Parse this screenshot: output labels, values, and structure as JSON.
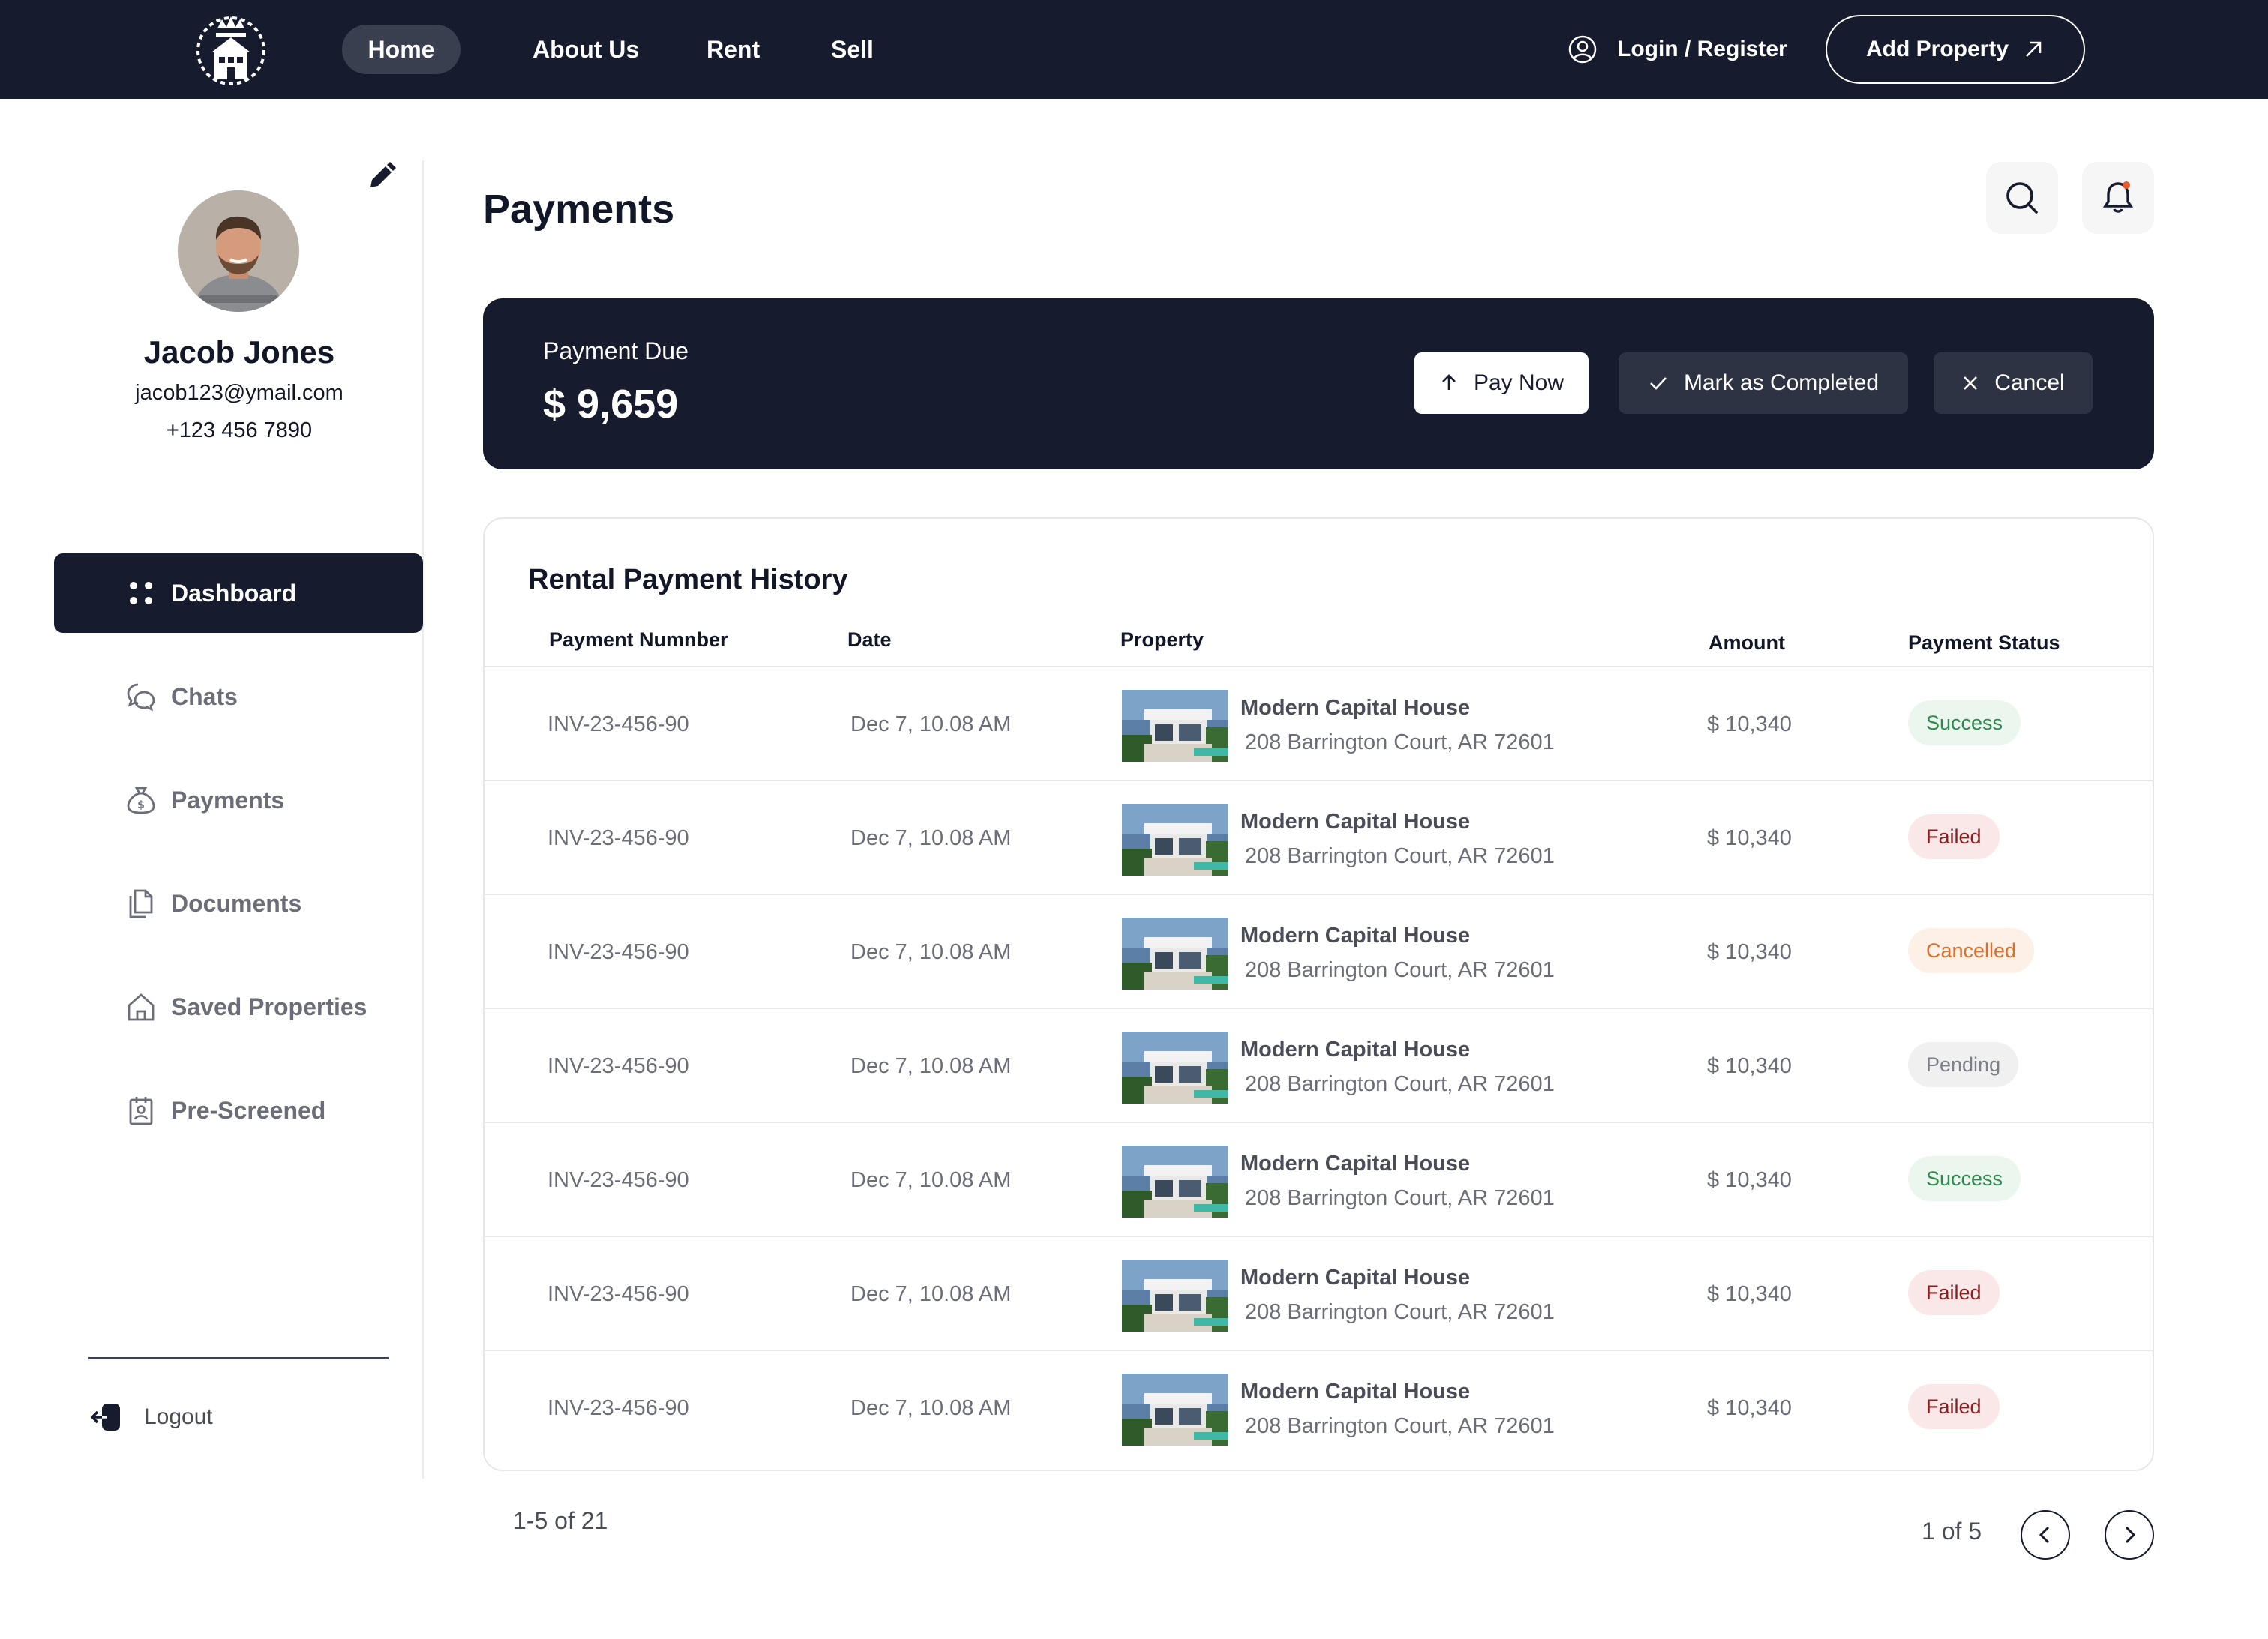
{
  "nav": {
    "links": [
      "Home",
      "About Us",
      "Rent",
      "Sell"
    ],
    "login_label": "Login / Register",
    "add_property_label": "Add Property"
  },
  "profile": {
    "name": "Jacob Jones",
    "email": "jacob123@ymail.com",
    "phone": "+123 456 7890"
  },
  "sidebar": {
    "items": [
      {
        "label": "Dashboard",
        "icon": "grid-dots-icon",
        "active": true
      },
      {
        "label": "Chats",
        "icon": "chat-bubbles-icon",
        "active": false
      },
      {
        "label": "Payments",
        "icon": "money-bag-icon",
        "active": false
      },
      {
        "label": "Documents",
        "icon": "documents-icon",
        "active": false
      },
      {
        "label": "Saved Properties",
        "icon": "home-icon",
        "active": false
      },
      {
        "label": "Pre-Screened",
        "icon": "clipboard-user-icon",
        "active": false
      }
    ],
    "logout_label": "Logout"
  },
  "main": {
    "title": "Payments",
    "due": {
      "label": "Payment Due",
      "amount": "$ 9,659",
      "pay_now": "Pay Now",
      "mark_completed": "Mark as Completed",
      "cancel": "Cancel"
    },
    "history": {
      "title": "Rental Payment History",
      "columns": [
        "Payment Numnber",
        "Date",
        "Property",
        "Amount",
        "Payment Status"
      ],
      "rows": [
        {
          "number": "INV-23-456-90",
          "date": "Dec 7, 10.08 AM",
          "property": "Modern Capital House",
          "address": "208 Barrington Court, AR 72601",
          "amount": "$ 10,340",
          "status": "Success",
          "status_kind": "success"
        },
        {
          "number": "INV-23-456-90",
          "date": "Dec 7, 10.08 AM",
          "property": "Modern Capital House",
          "address": "208 Barrington Court, AR 72601",
          "amount": "$ 10,340",
          "status": "Failed",
          "status_kind": "failed"
        },
        {
          "number": "INV-23-456-90",
          "date": "Dec 7, 10.08 AM",
          "property": "Modern Capital House",
          "address": "208 Barrington Court, AR 72601",
          "amount": "$ 10,340",
          "status": "Cancelled",
          "status_kind": "cancelled"
        },
        {
          "number": "INV-23-456-90",
          "date": "Dec 7, 10.08 AM",
          "property": "Modern Capital House",
          "address": "208 Barrington Court, AR 72601",
          "amount": "$ 10,340",
          "status": "Pending",
          "status_kind": "pending"
        },
        {
          "number": "INV-23-456-90",
          "date": "Dec 7, 10.08 AM",
          "property": "Modern Capital House",
          "address": "208 Barrington Court, AR 72601",
          "amount": "$ 10,340",
          "status": "Success",
          "status_kind": "success"
        },
        {
          "number": "INV-23-456-90",
          "date": "Dec 7, 10.08 AM",
          "property": "Modern Capital House",
          "address": "208 Barrington Court, AR 72601",
          "amount": "$ 10,340",
          "status": "Failed",
          "status_kind": "failed"
        },
        {
          "number": "INV-23-456-90",
          "date": "Dec 7, 10.08 AM",
          "property": "Modern Capital House",
          "address": "208 Barrington Court, AR 72601",
          "amount": "$ 10,340",
          "status": "Failed",
          "status_kind": "failed"
        }
      ]
    },
    "pagination": {
      "range": "1-5 of 21",
      "page": "1 of 5"
    }
  },
  "colors": {
    "navy": "#161b2e",
    "success": "#2f8a4d",
    "failed": "#8c1f1f",
    "cancelled": "#d9702b",
    "pending": "#7c7f87"
  }
}
